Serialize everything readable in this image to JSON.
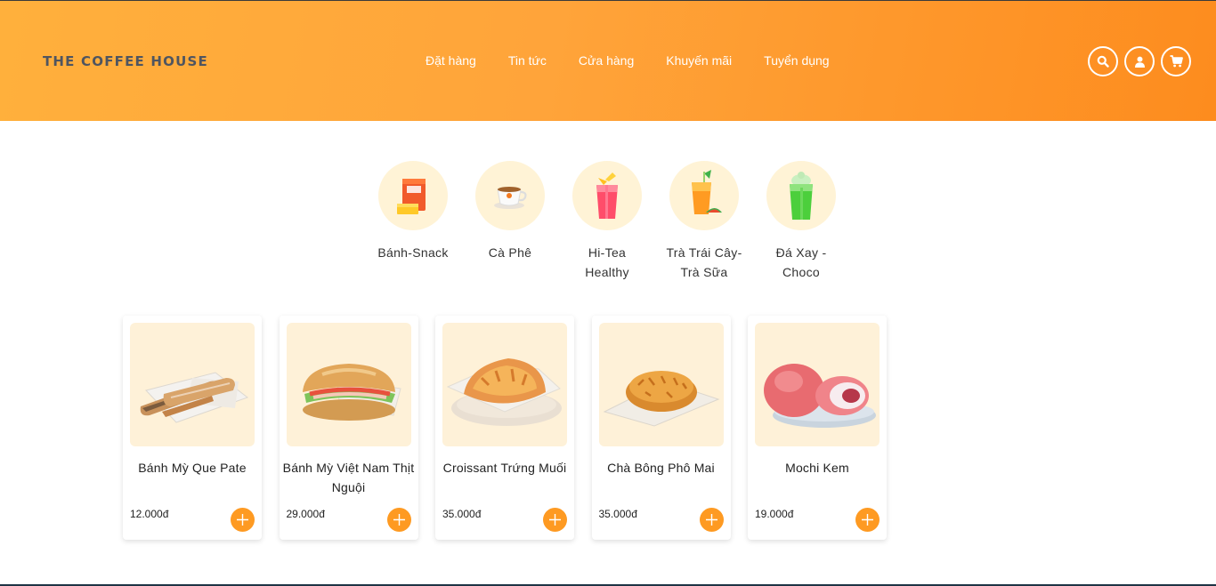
{
  "header": {
    "logo": "THE COFFEE HOUSE",
    "nav": [
      "Đặt hàng",
      "Tin tức",
      "Cửa hàng",
      "Khuyến mãi",
      "Tuyển dụng"
    ],
    "icons": [
      "search-icon",
      "user-icon",
      "cart-icon"
    ]
  },
  "categories": [
    {
      "label": "Bánh-Snack",
      "icon": "snack-box-icon"
    },
    {
      "label": "Cà Phê",
      "icon": "coffee-cup-icon"
    },
    {
      "label": "Hi-Tea Healthy",
      "icon": "red-tea-cup-icon"
    },
    {
      "label": "Trà Trái Cây-Trà Sữa",
      "icon": "fruit-tea-icon"
    },
    {
      "label": "Đá Xay - Choco",
      "icon": "green-smoothie-icon"
    }
  ],
  "products": [
    {
      "name": "Bánh Mỳ Que Pate",
      "price": "12.000đ",
      "image": "pate-baguette-sticks"
    },
    {
      "name": "Bánh Mỳ Việt Nam Thịt Nguội",
      "price": "29.000đ",
      "image": "banh-mi-sandwich"
    },
    {
      "name": "Croissant Trứng Muối",
      "price": "35.000đ",
      "image": "salted-egg-croissant"
    },
    {
      "name": "Chà Bông Phô Mai",
      "price": "35.000đ",
      "image": "pork-floss-cheese-bun"
    },
    {
      "name": "Mochi Kem",
      "price": "19.000đ",
      "image": "ice-cream-mochi"
    }
  ],
  "colors": {
    "header_start": "#ffb03c",
    "header_end": "#fd8c1e",
    "logo": "#4f5560",
    "accent": "#fe9a22",
    "category_bg": "#fff3d6",
    "product_bg": "#fef1d8"
  }
}
